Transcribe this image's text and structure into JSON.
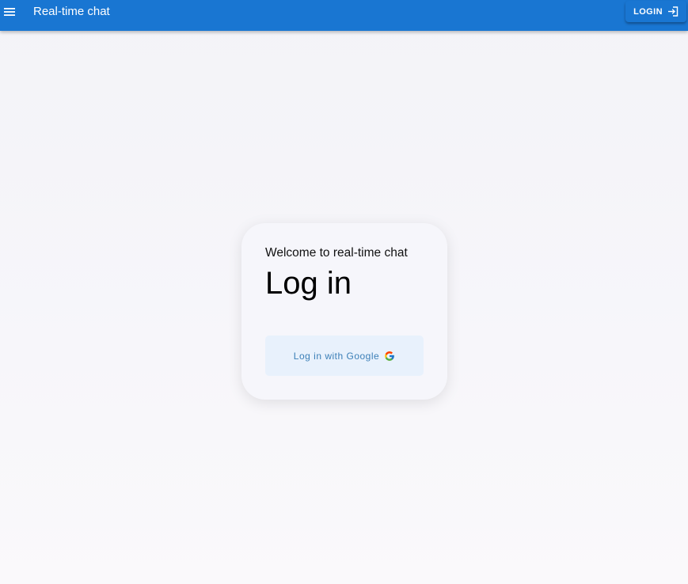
{
  "appbar": {
    "title": "Real-time chat",
    "menu_icon": "hamburger-menu-icon",
    "login_label": "LOGIN",
    "login_icon": "login-arrow-icon",
    "color": "#1976d2"
  },
  "card": {
    "welcome": "Welcome to real-time chat",
    "heading": "Log in",
    "google_button_label": "Log in with Google",
    "google_icon": "google-g-icon",
    "button_bg": "#e8f1fc"
  }
}
